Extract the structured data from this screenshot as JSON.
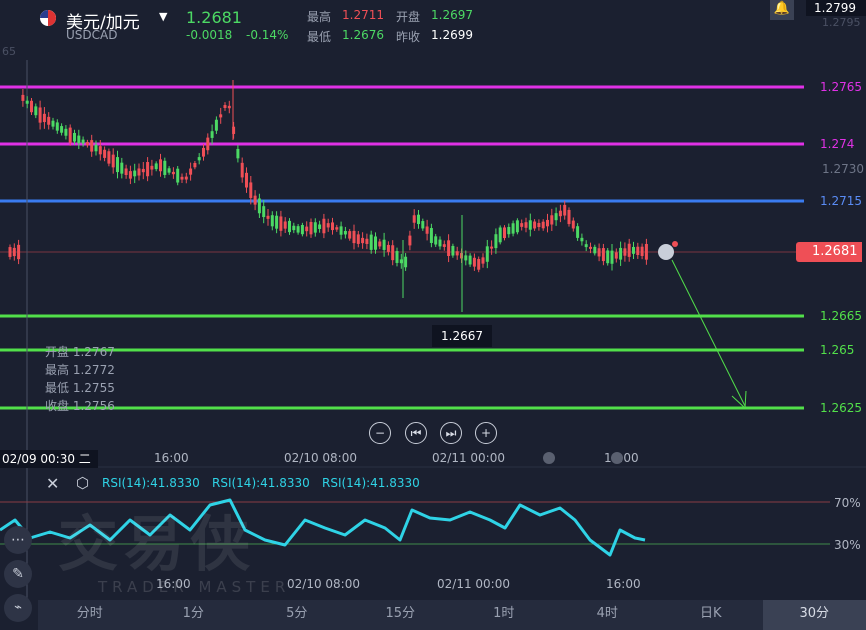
{
  "header": {
    "title": "美元/加元",
    "symbol": "USDCAD",
    "price": "1.2681",
    "change": "-0.0018",
    "change_pct": "-0.14%",
    "high_label": "最高",
    "high": "1.2711",
    "open_label": "开盘",
    "open": "1.2697",
    "low_label": "最低",
    "low": "1.2676",
    "prev_label": "昨收",
    "prev": "1.2699"
  },
  "axis": {
    "top_price": "1.2799",
    "faded_top": "1.2795",
    "faded_left": "65",
    "mid_price": "1.2730",
    "current_price": "1.2681",
    "low_marker": "1.2667"
  },
  "levels": [
    {
      "label": "1.2765",
      "color": "#e031e6"
    },
    {
      "label": "1.274",
      "color": "#e031e6"
    },
    {
      "label": "1.2715",
      "color": "#3a7bf0"
    },
    {
      "label": "1.2665",
      "color": "#52e04a"
    },
    {
      "label": "1.265",
      "color": "#52e04a"
    },
    {
      "label": "1.2625",
      "color": "#52e04a"
    }
  ],
  "ohlc_box": {
    "open_label": "开盘",
    "open": "1.2767",
    "high_label": "最高",
    "high": "1.2772",
    "low_label": "最低",
    "low": "1.2755",
    "close_label": "收盘",
    "close": "1.2756"
  },
  "time_axis": {
    "crosshair": "02/09 00:30 二",
    "ticks": [
      "16:00",
      "02/10 08:00",
      "02/11 00:00",
      "16:00"
    ]
  },
  "rsi": {
    "label1": "RSI(14):41.8330",
    "label2": "RSI(14):41.8330",
    "label3": "RSI(14):41.8330",
    "level_high": "70%",
    "level_low": "30%",
    "ticks": [
      "16:00",
      "02/10 08:00",
      "02/11 00:00",
      "16:00"
    ]
  },
  "watermark": {
    "big": "交易侠",
    "small": "TRADER MASTER"
  },
  "tabs": [
    "分时",
    "1分",
    "5分",
    "15分",
    "1时",
    "4时",
    "日K",
    "30分"
  ],
  "colors": {
    "up": "#4cd964",
    "down": "#ef4f56",
    "accent_rsi": "#2fd3e6",
    "bg": "#1b2030"
  }
}
